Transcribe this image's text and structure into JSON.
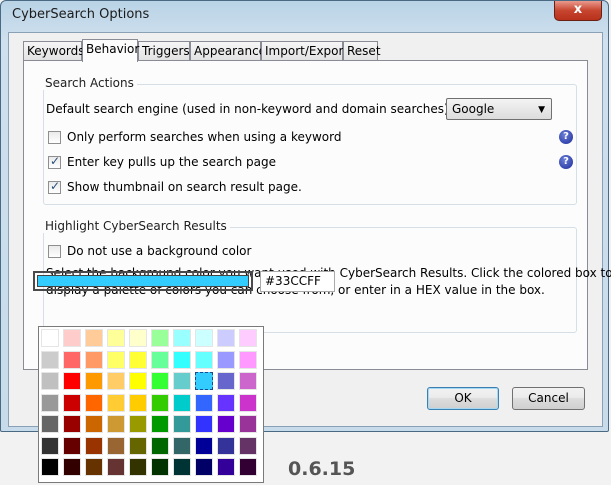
{
  "window": {
    "title": "CyberSearch Options",
    "close_glyph": "x"
  },
  "tabs": [
    "Keywords",
    "Behavior",
    "Triggers",
    "Appearance",
    "Import/Export",
    "Reset"
  ],
  "active_tab": "Behavior",
  "search_actions": {
    "legend": "Search Actions",
    "engine_label": "Default search engine (used in non-keyword and domain searches):",
    "engine_value": "Google",
    "options": [
      {
        "label": "Only perform searches when using a keyword",
        "checked": false,
        "help": true
      },
      {
        "label": "Enter key pulls up the search page",
        "checked": true,
        "help": true
      },
      {
        "label": "Show thumbnail on search result page.",
        "checked": true,
        "help": false
      }
    ]
  },
  "highlight": {
    "legend": "Highlight CyberSearch Results",
    "no_bg_label": "Do not use a background color",
    "no_bg_checked": false,
    "desc_line1": "Select the background color you want used with CyberSearch Results. Click the colored box to",
    "desc_line2": "display a palette of colors you can choose from, or enter in a HEX value in the box.",
    "color": "#33CCFF",
    "hex_value": "#33CCFF"
  },
  "buttons": {
    "ok": "OK",
    "cancel": "Cancel"
  },
  "backdrop": {
    "text_fragment": "r",
    "version": "0.6.15"
  },
  "help_glyph": "?",
  "check_glyph": "✓",
  "palette": {
    "selected_row": 2,
    "selected_col": 7,
    "rows": [
      [
        "#FFFFFF",
        "#FFCCCC",
        "#FFCC99",
        "#FFFF99",
        "#FFFFCC",
        "#99FF99",
        "#99FFFF",
        "#CCFFFF",
        "#CCCCFF",
        "#FFCCFF"
      ],
      [
        "#CCCCCC",
        "#FF6666",
        "#FF9966",
        "#FFFF66",
        "#FFFF33",
        "#66FF99",
        "#33FFFF",
        "#66FFFF",
        "#9999FF",
        "#FF99FF"
      ],
      [
        "#C0C0C0",
        "#FF0000",
        "#FF9900",
        "#FFCC66",
        "#FFFF00",
        "#33FF33",
        "#66CCCC",
        "#33CCFF",
        "#6666CC",
        "#CC66CC"
      ],
      [
        "#999999",
        "#CC0000",
        "#FF6600",
        "#FFCC33",
        "#FFCC00",
        "#33CC00",
        "#00CCCC",
        "#3366FF",
        "#6633FF",
        "#CC33CC"
      ],
      [
        "#666666",
        "#990000",
        "#CC6600",
        "#CC9933",
        "#999900",
        "#009900",
        "#339999",
        "#3333FF",
        "#6600CC",
        "#993399"
      ],
      [
        "#333333",
        "#660000",
        "#993300",
        "#996633",
        "#666600",
        "#006600",
        "#336666",
        "#000099",
        "#333399",
        "#663366"
      ],
      [
        "#000000",
        "#330000",
        "#663300",
        "#663333",
        "#333300",
        "#003300",
        "#003333",
        "#000066",
        "#330099",
        "#330033"
      ]
    ]
  }
}
